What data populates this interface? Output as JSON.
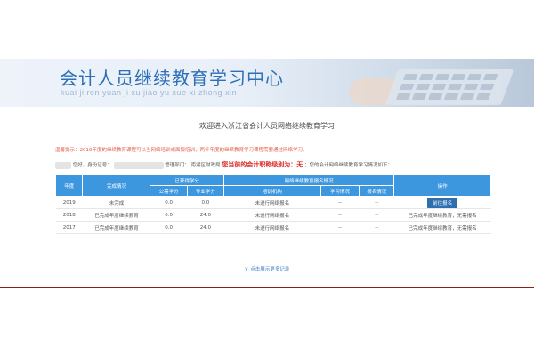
{
  "header": {
    "title": "会计人员继续教育学习中心",
    "subtitle": "kuai ji ren yuan ji xu jiao yu xue xi zhong xin"
  },
  "welcome": "欢迎进入浙江省会计人员网络继续教育学习",
  "notice": "温馨提示：2019年度的继续教育课程可以当网络培训或面授培训，两年年度的继续教育学习课程需要通过网络学习。",
  "user": {
    "greeting": "您好，身份证号：",
    "mgmt_label": "管理部门：",
    "dept": "南湖区财政局",
    "level_text": "您当前的会计职称级别为：无",
    "records_text": "；您的会计网络继续教育学习情况如下："
  },
  "table": {
    "headers": {
      "year": "年度",
      "status": "完成情况",
      "credits": "已获得学分",
      "public": "公需学分",
      "professional": "专业学分",
      "network": "网络继续教育报名情况",
      "institution": "培训机构",
      "study": "学习情况",
      "signup": "报名情况",
      "action": "操作"
    },
    "rows": [
      {
        "year": "2019",
        "status": "未完成",
        "public": "0.0",
        "professional": "0.0",
        "institution": "未进行网络报名",
        "study": "--",
        "signup": "--",
        "action": "前往报名"
      },
      {
        "year": "2018",
        "status": "已完成年度继续教育",
        "public": "0.0",
        "professional": "24.0",
        "institution": "未进行网络报名",
        "study": "--",
        "signup": "--",
        "action": "已完成年度继续教育，无需报名"
      },
      {
        "year": "2017",
        "status": "已完成年度继续教育",
        "public": "0.0",
        "professional": "24.0",
        "institution": "未进行网络报名",
        "study": "--",
        "signup": "--",
        "action": "已完成年度继续教育，无需报名"
      }
    ]
  },
  "more_link": "点击展示更多记录",
  "colors": {
    "accent": "#3d97df",
    "button": "#2d6fb0",
    "alert": "#d9241f",
    "notice": "#e25a43",
    "footer": "#8a1f1a"
  }
}
